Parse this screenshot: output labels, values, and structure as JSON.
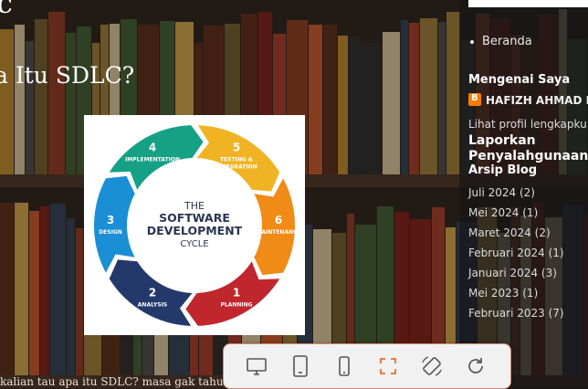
{
  "site": {
    "title": "C"
  },
  "post": {
    "title": "a Itu SDLC?",
    "excerpt": "kalian tau apa itu SDLC? masa gak tahu sih , ay",
    "diagram": {
      "center_lines": [
        "THE",
        "SOFTWARE",
        "DEVELOPMENT",
        "CYCLE"
      ],
      "steps": [
        {
          "num": "1",
          "label": "PLANNING",
          "color": "#c0272d"
        },
        {
          "num": "2",
          "label": "ANALYSIS",
          "color": "#24396b"
        },
        {
          "num": "3",
          "label": "DESIGN",
          "color": "#1a8fd6"
        },
        {
          "num": "4",
          "label": "IMPLEMENTATION",
          "color": "#16a085"
        },
        {
          "num": "5",
          "label": "TESTING &",
          "label2": "INTEGRATION",
          "color": "#f0b323"
        },
        {
          "num": "6",
          "label": "MAINTENANCE",
          "color": "#ef8b16"
        }
      ]
    }
  },
  "sidebar": {
    "nav": [
      {
        "label": "Beranda"
      }
    ],
    "about_title": "Mengenai Saya",
    "author_name": "HAFIZH AHMAD RA",
    "profile_link": "Lihat profil lengkapku",
    "report_title": "Laporkan Penyalahgunaan",
    "archive_title": "Arsip Blog",
    "archive": [
      {
        "label": "Juli 2024",
        "count": "(2)"
      },
      {
        "label": "Mei 2024",
        "count": "(1)"
      },
      {
        "label": "Maret 2024",
        "count": "(2)"
      },
      {
        "label": "Februari 2024",
        "count": "(1)"
      },
      {
        "label": "Januari 2024",
        "count": "(3)"
      },
      {
        "label": "Mei 2023",
        "count": "(1)"
      },
      {
        "label": "Februari 2023",
        "count": "(7)"
      }
    ]
  },
  "toolbar": {
    "buttons": [
      {
        "icon": "desktop-icon"
      },
      {
        "icon": "tablet-icon"
      },
      {
        "icon": "phone-icon"
      },
      {
        "icon": "fullscreen-icon",
        "active_color": "#e8702a"
      },
      {
        "icon": "rotate-icon"
      },
      {
        "icon": "refresh-icon"
      }
    ]
  }
}
